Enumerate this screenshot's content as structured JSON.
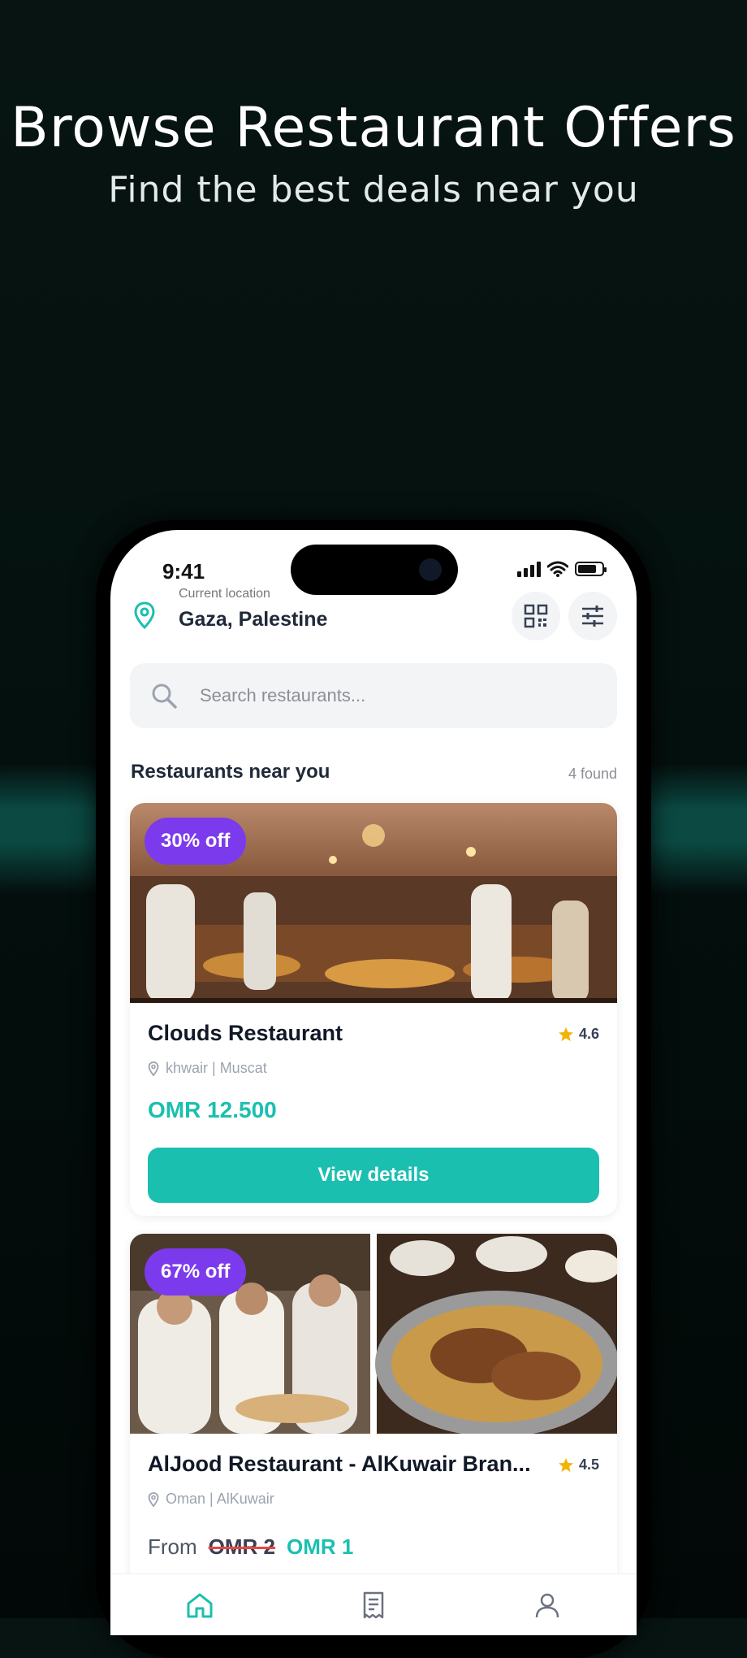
{
  "hero": {
    "title": "Browse Restaurant Offers",
    "subtitle": "Find the best deals near you"
  },
  "status_bar": {
    "time": "9:41"
  },
  "location": {
    "caption": "Current location",
    "name": "Gaza, Palestine"
  },
  "search": {
    "placeholder": "Search restaurants..."
  },
  "section": {
    "title": "Restaurants near you",
    "count": "4 found"
  },
  "restaurants": [
    {
      "badge": "30% off",
      "name": "Clouds Restaurant",
      "rating": "4.6",
      "address": "khwair | Muscat",
      "price": "OMR 12.500",
      "button": "View details"
    },
    {
      "badge": "67% off",
      "name": "AlJood Restaurant - AlKuwair Bran...",
      "rating": "4.5",
      "address": "Oman | AlKuwair",
      "price_from": "From",
      "price_old": "OMR 2",
      "price_new": "OMR 1"
    }
  ],
  "tabs": [
    {
      "icon": "home-icon",
      "active": true
    },
    {
      "icon": "receipt-icon",
      "active": false
    },
    {
      "icon": "profile-icon",
      "active": false
    }
  ],
  "colors": {
    "accent": "#1bbfb0",
    "badge": "#7c3aed",
    "star": "#f5b301",
    "strike": "#ef4444"
  }
}
